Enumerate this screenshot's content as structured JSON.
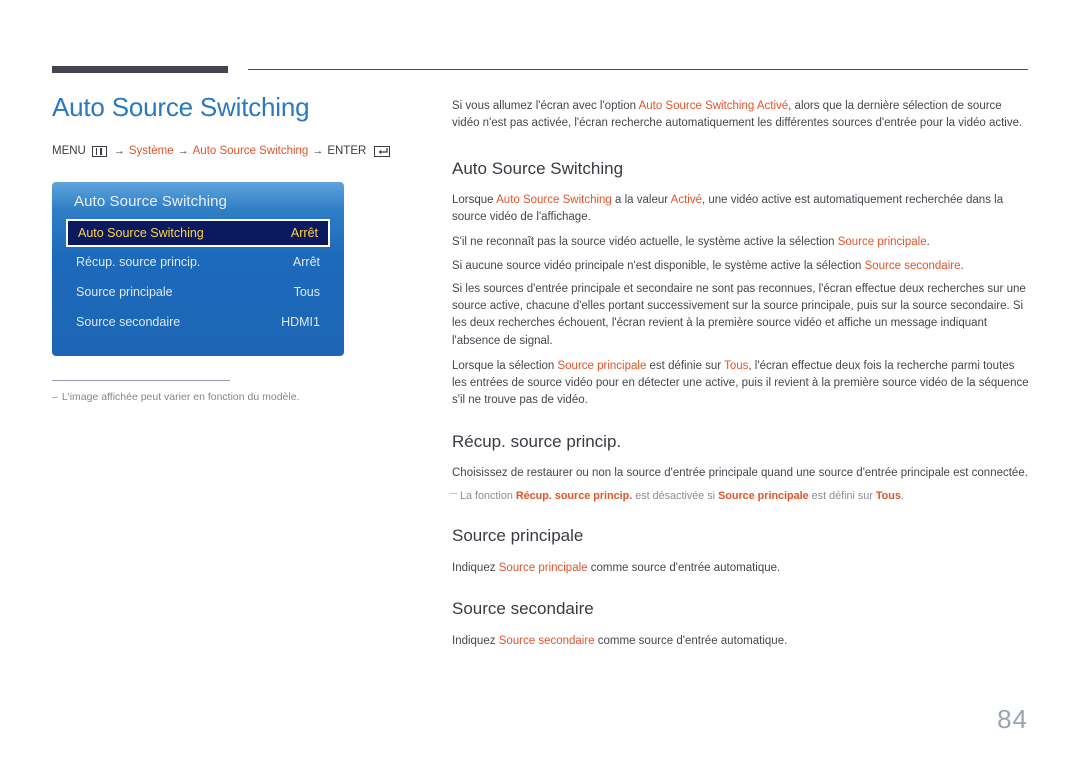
{
  "page": {
    "title": "Auto Source Switching",
    "number": "84"
  },
  "breadcrumb": {
    "menu_label": "MENU",
    "menu_icon": "menu-bars-icon",
    "arrow": "→",
    "item1": "Système",
    "item2": "Auto Source Switching",
    "enter_label": "ENTER",
    "enter_icon": "enter-return-icon"
  },
  "osd": {
    "title": "Auto Source Switching",
    "rows": [
      {
        "label": "Auto Source Switching",
        "value": "Arrêt",
        "selected": true
      },
      {
        "label": "Récup. source princip.",
        "value": "Arrêt",
        "selected": false
      },
      {
        "label": "Source principale",
        "value": "Tous",
        "selected": false
      },
      {
        "label": "Source secondaire",
        "value": "HDMI1",
        "selected": false
      }
    ]
  },
  "left_note": {
    "dash": "–",
    "text": "L'image affichée peut varier en fonction du modèle."
  },
  "content": {
    "intro": {
      "a": "Si vous allumez l'écran avec l'option ",
      "accent1": "Auto Source Switching Activé",
      "b": ", alors que la dernière sélection de source vidéo n'est pas activée, l'écran recherche automatiquement les différentes sources d'entrée pour la vidéo active."
    },
    "section1": {
      "heading": "Auto Source Switching",
      "p1_a": "Lorsque ",
      "p1_accent1": "Auto Source Switching",
      "p1_b": " a la valeur ",
      "p1_accent2": "Activé",
      "p1_c": ", une vidéo active est automatiquement recherchée dans la source vidéo de l'affichage.",
      "p2_a": "S'il ne reconnaît pas la source vidéo actuelle, le système active la sélection ",
      "p2_accent1": "Source principale",
      "p2_b": ".",
      "p3_a": "Si aucune source vidéo principale n'est disponible, le système active la sélection ",
      "p3_accent1": "Source secondaire",
      "p3_b": ".",
      "p4": "Si les sources d'entrée principale et secondaire ne sont pas reconnues, l'écran effectue deux recherches sur une source active, chacune d'elles portant successivement sur la source principale, puis sur la source secondaire. Si les deux recherches échouent, l'écran revient à la première source vidéo et affiche un message indiquant l'absence de signal.",
      "p5_a": "Lorsque la sélection ",
      "p5_accent1": "Source principale",
      "p5_b": " est définie sur ",
      "p5_accent2": "Tous",
      "p5_c": ", l'écran effectue deux fois la recherche parmi toutes les entrées de source vidéo pour en détecter une active, puis il revient à la première source vidéo de la séquence s'il ne trouve pas de vidéo."
    },
    "section2": {
      "heading": "Récup. source princip.",
      "p1": "Choisissez de restaurer ou non la source d'entrée principale quand une source d'entrée principale est connectée.",
      "note_dash": "─",
      "note_a": "La fonction ",
      "note_accent1": "Récup. source princip.",
      "note_b": " est désactivée si ",
      "note_accent2": "Source principale",
      "note_c": " est défini sur ",
      "note_accent3": "Tous",
      "note_d": "."
    },
    "section3": {
      "heading": "Source principale",
      "p1_a": "Indiquez ",
      "p1_accent1": "Source principale",
      "p1_b": " comme source d'entrée automatique."
    },
    "section4": {
      "heading": "Source secondaire",
      "p1_a": "Indiquez ",
      "p1_accent1": "Source secondaire",
      "p1_b": " comme source d'entrée automatique."
    }
  },
  "colors": {
    "title_blue": "#2a79c0",
    "accent_orange": "#e2542a",
    "osd_blue": "#1d69ba",
    "osd_selected_bg": "#0b1a5e",
    "osd_selected_text": "#ffd24d",
    "rule_dark": "#45434f",
    "page_number": "#9aa3b0"
  }
}
